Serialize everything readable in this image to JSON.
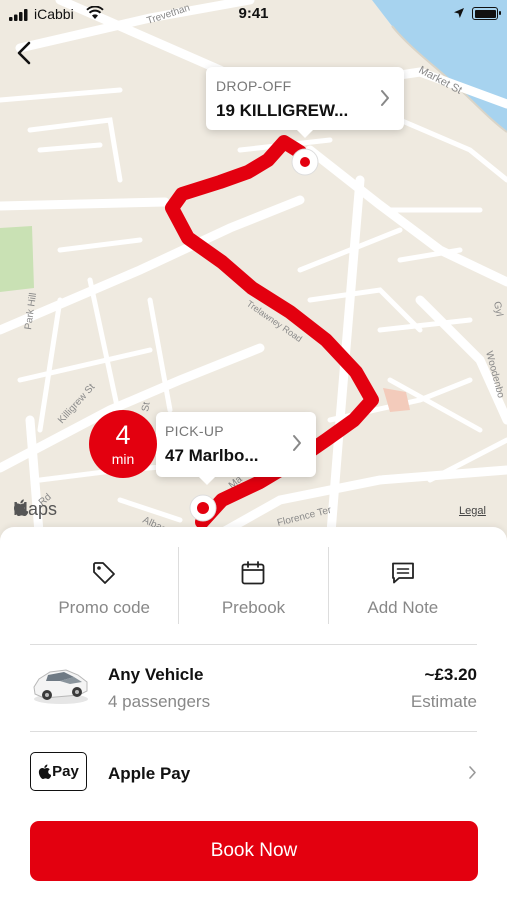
{
  "status_bar": {
    "carrier": "iCabbi",
    "time": "9:41",
    "icons": [
      "signal-icon",
      "wifi-icon",
      "location-arrow-icon",
      "battery-icon"
    ]
  },
  "map": {
    "attribution": "Maps",
    "legal": "Legal",
    "street_labels": [
      "Trevethan",
      "Market St",
      "Park Hill",
      "Killigrew St",
      "Trelawney Road",
      "St",
      "Albany Rd",
      "Florence Ter",
      "Woodenbo",
      "Gyl",
      "Ma",
      "Rd"
    ],
    "route_color": "#e3000f",
    "dropoff": {
      "label": "DROP-OFF",
      "address": "19 KILLIGREW..."
    },
    "pickup": {
      "label": "PICK-UP",
      "address": "47 Marlbo...",
      "eta_value": "4",
      "eta_unit": "min"
    }
  },
  "options": [
    {
      "label": "Promo code",
      "icon": "tag-icon"
    },
    {
      "label": "Prebook",
      "icon": "calendar-icon"
    },
    {
      "label": "Add Note",
      "icon": "note-icon"
    }
  ],
  "vehicle": {
    "name": "Any Vehicle",
    "passengers": "4 passengers",
    "price": "~£3.20",
    "price_note": "Estimate",
    "icon": "car-icon"
  },
  "payment": {
    "badge": "Pay",
    "method": "Apple Pay",
    "icon": "apple-icon"
  },
  "book_button": "Book Now",
  "colors": {
    "accent": "#e3000f",
    "map_background": "#efeae0",
    "water": "#a7d3ef",
    "park": "#c9e1b4"
  }
}
